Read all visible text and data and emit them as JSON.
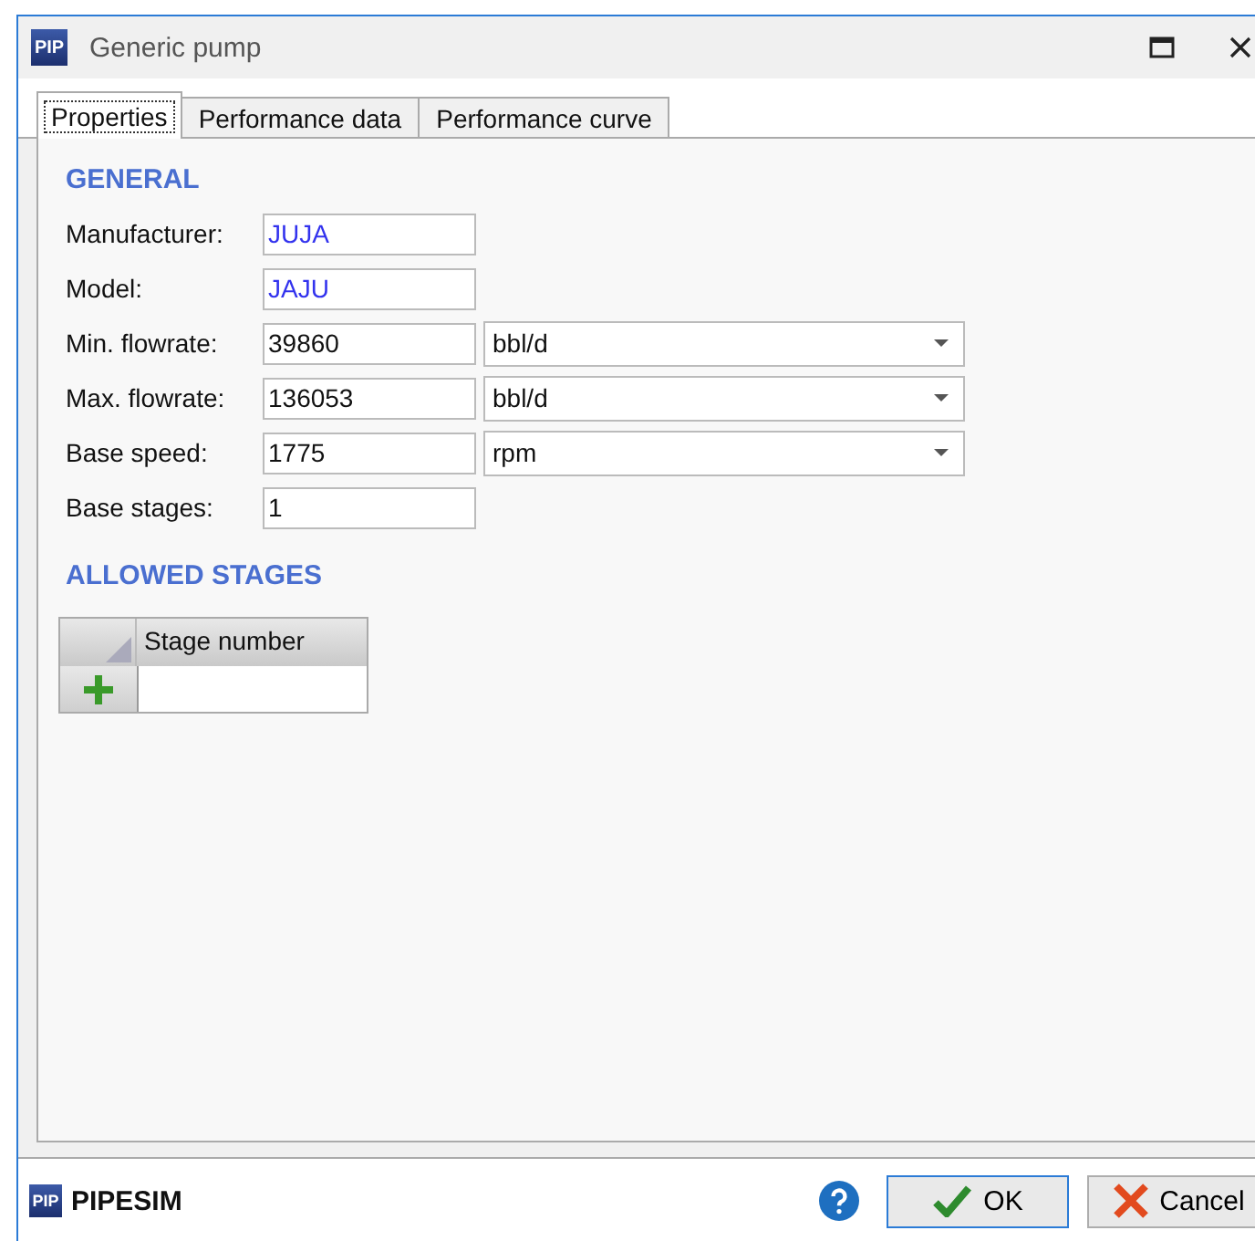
{
  "window": {
    "logo": "PIP",
    "title": "Generic pump"
  },
  "tabs": [
    {
      "label": "Properties",
      "selected": true
    },
    {
      "label": "Performance data",
      "selected": false
    },
    {
      "label": "Performance curve",
      "selected": false
    }
  ],
  "general": {
    "heading": "GENERAL",
    "fields": [
      {
        "kind": "text",
        "label": "Manufacturer:",
        "value": "JUJA",
        "highlighted": true
      },
      {
        "kind": "text",
        "label": "Model:",
        "value": "JAJU",
        "highlighted": true
      },
      {
        "kind": "unit",
        "label": "Min. flowrate:",
        "value": "39860",
        "highlighted": false,
        "unit": "bbl/d"
      },
      {
        "kind": "unit",
        "label": "Max. flowrate:",
        "value": "136053",
        "highlighted": false,
        "unit": "bbl/d"
      },
      {
        "kind": "unit",
        "label": "Base speed:",
        "value": "1775",
        "highlighted": false,
        "unit": "rpm"
      },
      {
        "kind": "text",
        "label": "Base stages:",
        "value": "1",
        "highlighted": false
      }
    ]
  },
  "allowed_stages": {
    "heading": "ALLOWED STAGES",
    "columns": [
      "Stage number"
    ]
  },
  "footer": {
    "logo": "PIP",
    "brand": "PIPESIM",
    "buttons": [
      {
        "kind": "ok",
        "label": "OK"
      },
      {
        "kind": "cancel",
        "label": "Cancel"
      }
    ]
  }
}
